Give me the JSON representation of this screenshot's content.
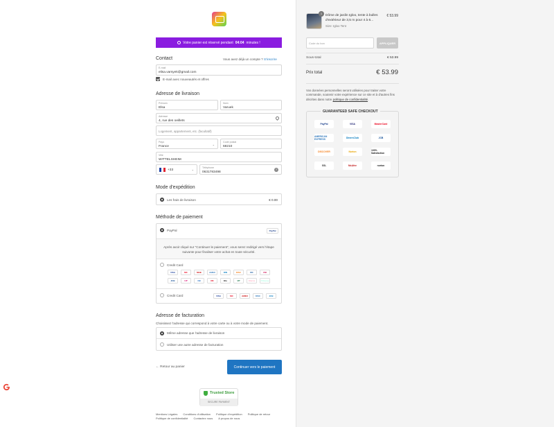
{
  "timer": {
    "text_before": "Votre panier est réservé pendant",
    "time": "04:04",
    "text_after": "minutes !"
  },
  "contact": {
    "title": "Contact",
    "have_account": "Vous avez déjà un compte ?",
    "login_link": "S'inscrire",
    "email_label": "E-mail",
    "email_value": "elisa.varsyek@gmail.com",
    "newsletter_label": "E-mail avec nouveautés et offres"
  },
  "shipping": {
    "title": "Adresse de livraison",
    "first_name_label": "Prénom",
    "first_name": "Elsa",
    "last_name_label": "Nom",
    "last_name": "Varuek",
    "address_label": "Adresse",
    "address": "4, rue des oeillets",
    "apt_placeholder": "Logement, appartement, etc. (facultatif)",
    "country_label": "Pays",
    "country": "France",
    "postal_label": "Code postal",
    "postal": "68210",
    "city_label": "Ville",
    "city": "WITTELSHEIM",
    "phone_prefix": "+33",
    "phone_label": "Téléphone",
    "phone": "0631783498"
  },
  "delivery": {
    "title": "Mode d'expédition",
    "option_label": "Les frais de livraison",
    "option_price": "€ 0.00"
  },
  "payment": {
    "title": "Méthode de paiement",
    "paypal_label": "PayPal",
    "paypal_info": "Après avoir cliqué sur \"Continuer le paiement\", vous serez redirigé vers l'étape suivante pour finaliser votre achat en toute sécurité.",
    "card1_label": "Credit Card",
    "card2_label": "Credit Card",
    "card1_logos": [
      "VISA",
      "MC",
      "MAE",
      "AMEX",
      "DIN",
      "DISC",
      "DC",
      "UNI",
      "JCB",
      "UP",
      "CB",
      "DK",
      "Elo",
      "VP",
      "Klarna",
      "Afterpay"
    ],
    "card2_logos": [
      "VISA",
      "MC",
      "AMEX",
      "DISC",
      "JCB"
    ]
  },
  "billing": {
    "title": "Adresse de facturation",
    "subtitle": "Choisissez l'adresse qui correspond à votre carte ou à votre mode de paiement.",
    "same_label": "Même adresse que l'adresse de livraison",
    "other_label": "Utiliser une autre adresse de facturation"
  },
  "actions": {
    "back": "Retour au panier",
    "continue": "Continuer vers le paiement"
  },
  "trust": {
    "label": "Trusted Store",
    "sub": "SECURE PAYMENT"
  },
  "footer": {
    "links_row1": [
      "Mentions Légales",
      "Conditions d'utilisation",
      "Politique d'expédition",
      "Politique de retour"
    ],
    "links_row2": [
      "Politique de confidentialité",
      "Contactez nous",
      "A propos de nous"
    ]
  },
  "order": {
    "qty": "1",
    "product_title": "Dôme de jardin Igloo, tente à bulles d'extérieur de 3,5 m pour 4 à 6...",
    "product_variant": "Size: Igloo Tent",
    "product_price": "€ 53.99",
    "coupon_placeholder": "Code du bon",
    "apply_label": "APPLIQUER",
    "subtotal_label": "Sous-total",
    "subtotal": "€ 53.99",
    "total_label": "Prix total",
    "total": "€ 53.99",
    "privacy_text": "Vos données personnelles seront utilisées pour traiter votre commande, soutenir votre expérience sur ce site et à d'autres fins décrites dans notre",
    "privacy_link": "politique de confidentialité",
    "guarantee_title": "GUARANTEED SAFE CHECKOUT",
    "guarantee_logos": [
      "PayPal",
      "VISA",
      "MasterCard",
      "AMERICAN EXPRESS",
      "DinersClub",
      "JCB",
      "DISCOVER",
      "Norton",
      "100% Satisfaction",
      "SSL",
      "McAfee",
      "norton"
    ]
  },
  "colors": {
    "accent_purple": "#8a1ce0",
    "primary_blue": "#1f75c2"
  }
}
